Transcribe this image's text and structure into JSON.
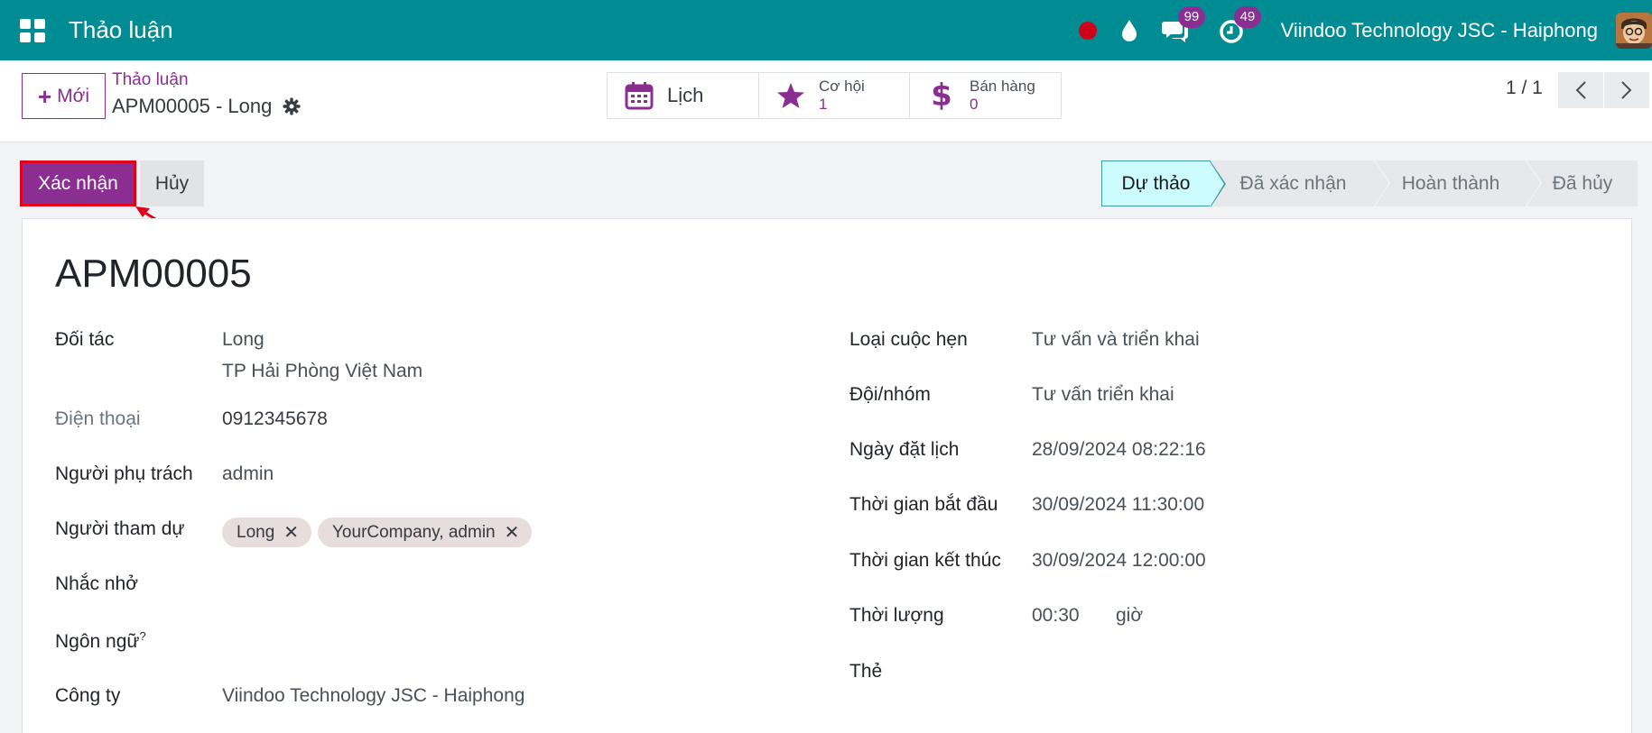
{
  "navbar": {
    "app_title": "Thảo luận",
    "messages_badge": "99",
    "activities_badge": "49",
    "company": "Viindoo Technology JSC - Haiphong"
  },
  "control": {
    "new_label": "Mới",
    "breadcrumb_parent": "Thảo luận",
    "breadcrumb_current": "APM00005 - Long",
    "smart_buttons": {
      "calendar_label": "Lịch",
      "opportunity_label": "Cơ hội",
      "opportunity_value": "1",
      "sales_label": "Bán hàng",
      "sales_value": "0"
    },
    "pager": "1 / 1"
  },
  "statusbar": {
    "confirm_label": "Xác nhận",
    "cancel_label": "Hủy",
    "stages": [
      "Dự thảo",
      "Đã xác nhận",
      "Hoàn thành",
      "Đã hủy"
    ],
    "active_stage": "Dự thảo"
  },
  "form": {
    "title": "APM00005",
    "left": {
      "partner_label": "Đối tác",
      "partner_name": "Long",
      "partner_address": "TP Hải Phòng Việt Nam",
      "phone_label": "Điện thoại",
      "phone_value": "0912345678",
      "responsible_label": "Người phụ trách",
      "responsible_value": "admin",
      "attendees_label": "Người tham dự",
      "attendees": [
        "Long",
        "YourCompany, admin"
      ],
      "reminder_label": "Nhắc nhở",
      "language_label": "Ngôn ngữ",
      "language_help": "?",
      "company_label": "Công ty",
      "company_value": "Viindoo Technology JSC - Haiphong"
    },
    "right": {
      "type_label": "Loại cuộc hẹn",
      "type_value": "Tư vấn và triển khai",
      "team_label": "Đội/nhóm",
      "team_value": "Tư vấn triển khai",
      "booked_label": "Ngày đặt lịch",
      "booked_value": "28/09/2024 08:22:16",
      "start_label": "Thời gian bắt đầu",
      "start_value": "30/09/2024 11:30:00",
      "end_label": "Thời gian kết thúc",
      "end_value": "30/09/2024 12:00:00",
      "duration_label": "Thời lượng",
      "duration_value": "00:30",
      "duration_unit": "giờ",
      "tags_label": "Thẻ"
    }
  },
  "colors": {
    "navbar": "#018c94",
    "primary": "#8a2f91",
    "annotation": "#e3001b",
    "active_stage": "#ccfbfd"
  },
  "icons": [
    "apps-grid-icon",
    "recording-dot-icon",
    "drop-icon",
    "chat-icon",
    "clock-icon",
    "calendar-icon",
    "star-icon",
    "dollar-icon",
    "gear-icon",
    "chevron-left-icon",
    "chevron-right-icon",
    "close-icon"
  ]
}
